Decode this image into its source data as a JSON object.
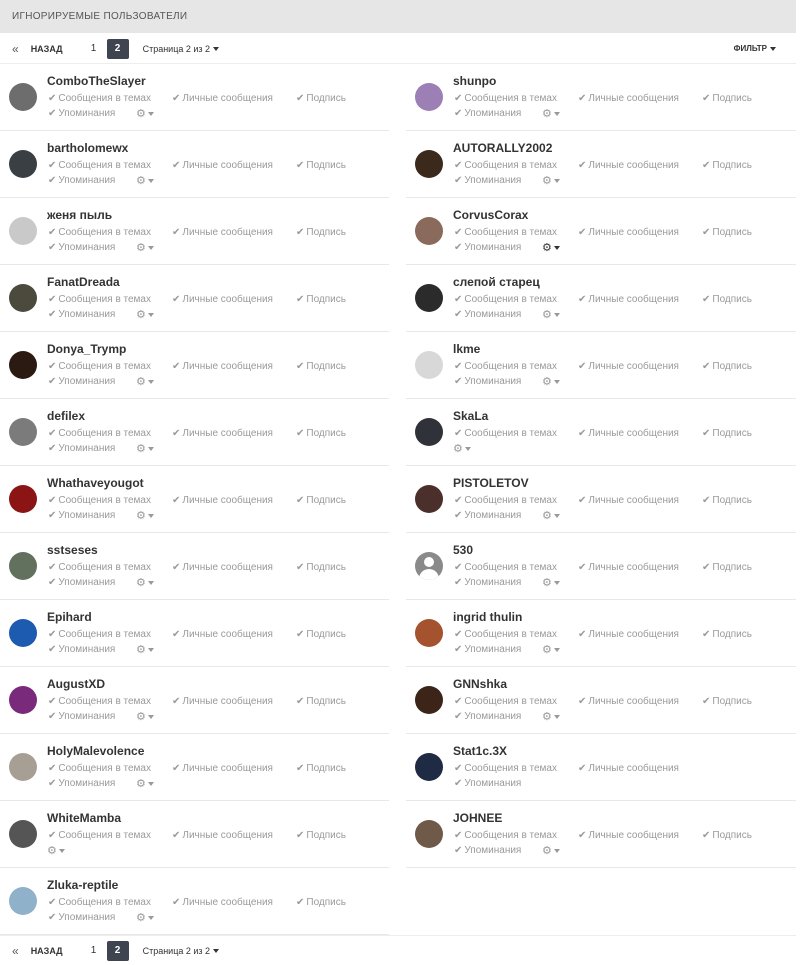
{
  "header": {
    "title": "ИГНОРИРУЕМЫЕ ПОЛЬЗОВАТЕЛИ"
  },
  "pagination": {
    "prev_arrow": "«",
    "prev_label": "НАЗАД",
    "pages": [
      "1",
      "2"
    ],
    "active_page": "2",
    "page_info": "Страница 2 из 2"
  },
  "filter": {
    "label": "ФИЛЬТР"
  },
  "option_labels": {
    "topics": "Сообщения в темах",
    "messages": "Личные сообщения",
    "signature": "Подпись",
    "mentions": "Упоминания"
  },
  "users_left": [
    {
      "name": "ComboTheSlayer",
      "avatar_color": "#6d6d6d",
      "options": [
        "topics",
        "messages",
        "signature",
        "mentions"
      ]
    },
    {
      "name": "bartholomewx",
      "avatar_color": "#3a3f44",
      "options": [
        "topics",
        "messages",
        "signature",
        "mentions"
      ]
    },
    {
      "name": "женя пыль",
      "avatar_color": "#c9c9c9",
      "options": [
        "topics",
        "messages",
        "signature",
        "mentions"
      ]
    },
    {
      "name": "FanatDreada",
      "avatar_color": "#4b4a3c",
      "options": [
        "topics",
        "messages",
        "signature",
        "mentions"
      ]
    },
    {
      "name": "Donya_Trymp",
      "avatar_color": "#2a1a12",
      "options": [
        "topics",
        "messages",
        "signature",
        "mentions"
      ]
    },
    {
      "name": "defilex",
      "avatar_color": "#7b7b7b",
      "options": [
        "topics",
        "messages",
        "signature",
        "mentions"
      ]
    },
    {
      "name": "Whathaveyougot",
      "avatar_color": "#8b1414",
      "options": [
        "topics",
        "messages",
        "signature",
        "mentions"
      ]
    },
    {
      "name": "sstseses",
      "avatar_color": "#62705e",
      "options": [
        "topics",
        "messages",
        "signature",
        "mentions"
      ]
    },
    {
      "name": "Epihard",
      "avatar_color": "#1d5bb0",
      "options": [
        "topics",
        "messages",
        "signature",
        "mentions"
      ]
    },
    {
      "name": "AugustXD",
      "avatar_color": "#7a2a7a",
      "options": [
        "topics",
        "messages",
        "signature",
        "mentions"
      ]
    },
    {
      "name": "HolyMalevolence",
      "avatar_color": "#a89f94",
      "options": [
        "topics",
        "messages",
        "signature",
        "mentions"
      ]
    },
    {
      "name": "WhiteMamba",
      "avatar_color": "#555555",
      "options": [
        "topics",
        "messages",
        "signature"
      ]
    },
    {
      "name": "Zluka-reptile",
      "avatar_color": "#8fb1c9",
      "options": [
        "topics",
        "messages",
        "signature",
        "mentions"
      ]
    }
  ],
  "users_right": [
    {
      "name": "shunpo",
      "avatar_color": "#9b7fb5",
      "options": [
        "topics",
        "messages",
        "signature",
        "mentions"
      ]
    },
    {
      "name": "AUTORALLY2002",
      "avatar_color": "#3b2a1c",
      "options": [
        "topics",
        "messages",
        "signature",
        "mentions"
      ]
    },
    {
      "name": "CorvusCorax",
      "avatar_color": "#8a6a5a",
      "options": [
        "topics",
        "messages",
        "signature",
        "mentions"
      ],
      "gear_dark": true
    },
    {
      "name": "слепой старец",
      "avatar_color": "#2b2b2b",
      "options": [
        "topics",
        "messages",
        "signature",
        "mentions"
      ]
    },
    {
      "name": "lkme",
      "avatar_color": "#d8d8d8",
      "options": [
        "topics",
        "messages",
        "signature",
        "mentions"
      ]
    },
    {
      "name": "SkaLa",
      "avatar_color": "#2f3238",
      "options": [
        "topics",
        "messages",
        "signature"
      ]
    },
    {
      "name": "PISTOLETOV",
      "avatar_color": "#4a2f2a",
      "options": [
        "topics",
        "messages",
        "signature",
        "mentions"
      ]
    },
    {
      "name": "530",
      "avatar_color": "#8a8a8a",
      "options": [
        "topics",
        "messages",
        "signature",
        "mentions"
      ],
      "silhouette": true
    },
    {
      "name": "ingrid thulin",
      "avatar_color": "#a5532e",
      "options": [
        "topics",
        "messages",
        "signature",
        "mentions"
      ]
    },
    {
      "name": "GNNshka",
      "avatar_color": "#3c2418",
      "options": [
        "topics",
        "messages",
        "signature",
        "mentions"
      ]
    },
    {
      "name": "Stat1c.3X",
      "avatar_color": "#1f2a44",
      "options": [
        "topics",
        "messages",
        "mentions"
      ],
      "no_gear": true
    },
    {
      "name": "JOHNEE",
      "avatar_color": "#6f5a4a",
      "options": [
        "topics",
        "messages",
        "signature",
        "mentions"
      ]
    }
  ]
}
